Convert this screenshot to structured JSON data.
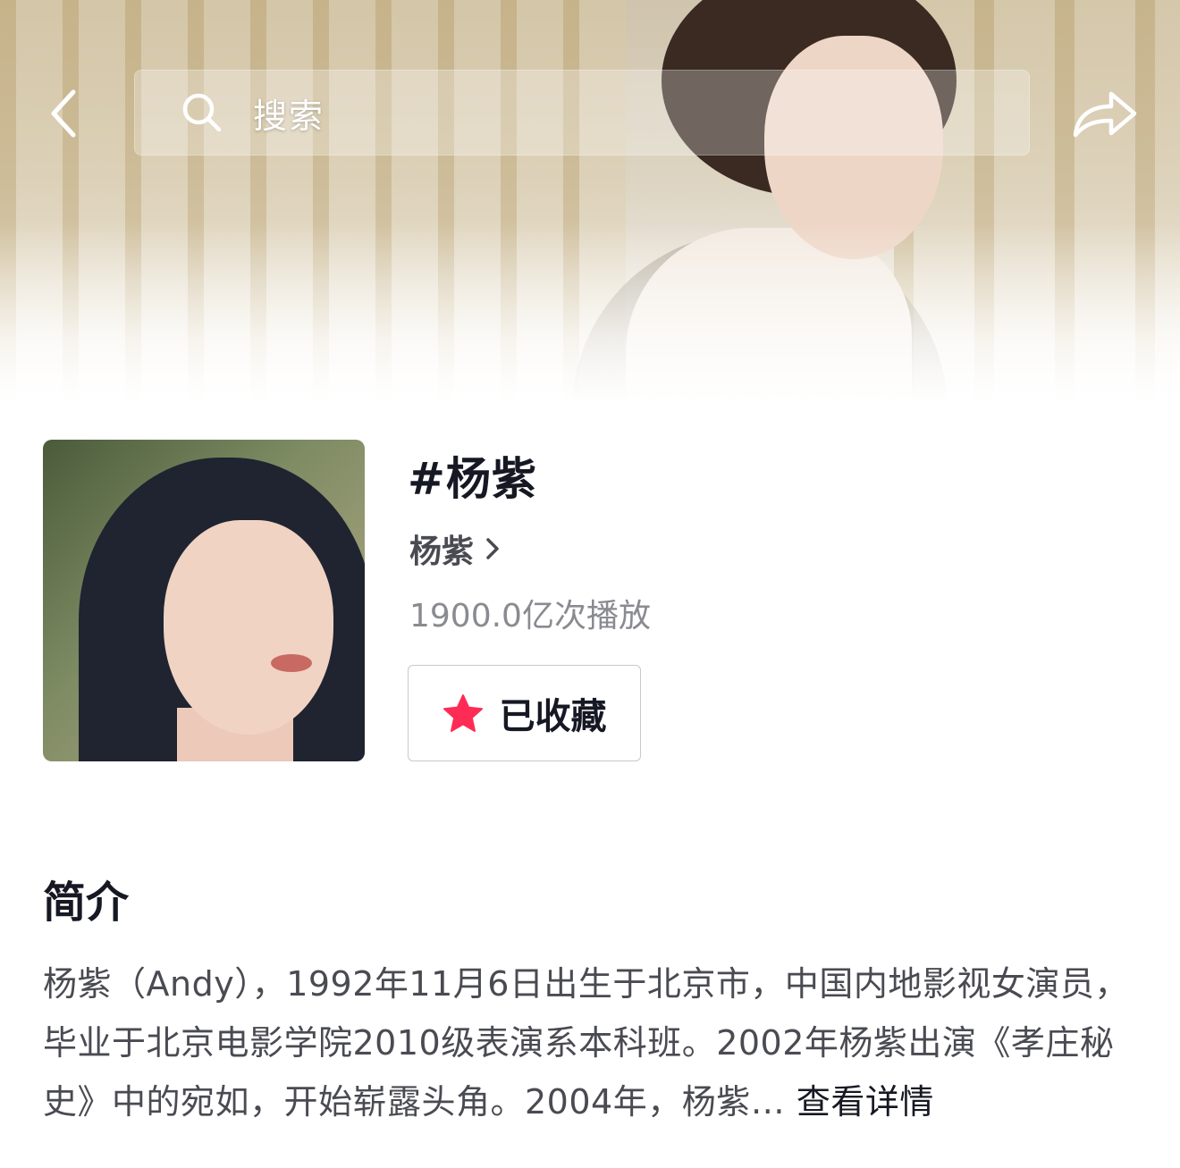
{
  "header": {
    "search_placeholder": "搜索",
    "back_icon": "chevron-left-icon",
    "search_icon": "search-icon",
    "share_icon": "share-arrow-icon"
  },
  "topic": {
    "title": "#杨紫",
    "creator": "杨紫",
    "play_count": "1900.0亿次播放",
    "favorite_label": "已收藏",
    "favorite_icon": "star-icon",
    "favorite_color": "#fe2c55"
  },
  "intro": {
    "heading": "简介",
    "text": "杨紫（Andy），1992年11月6日出生于北京市，中国内地影视女演员，毕业于北京电影学院2010级表演系本科班。2002年杨紫出演《孝庄秘史》中的宛如，开始崭露头角。2004年，杨紫…",
    "more_label": "查看详情"
  }
}
